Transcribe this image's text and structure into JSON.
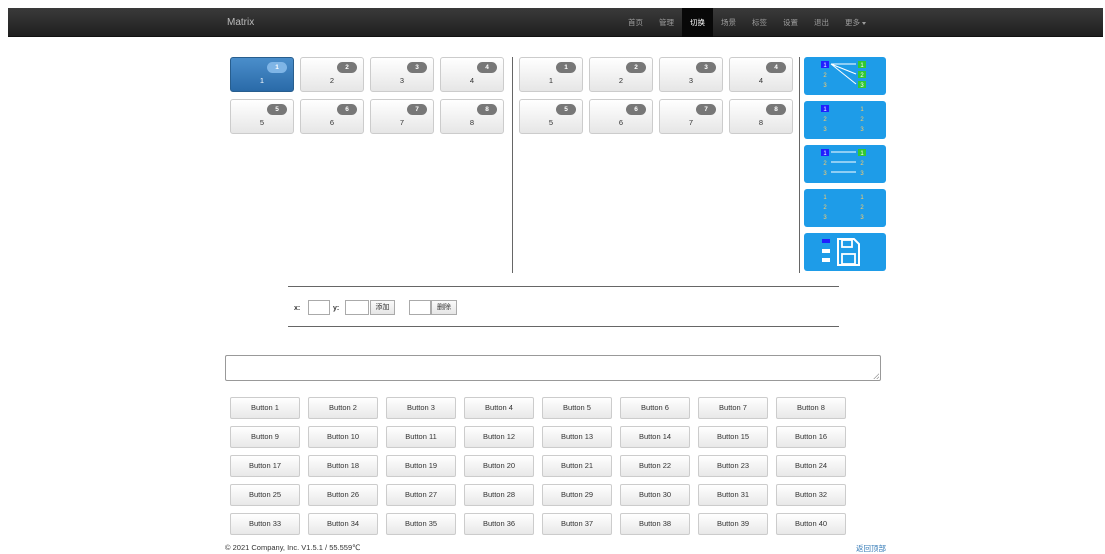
{
  "navbar": {
    "brand": "Matrix",
    "items": [
      {
        "label": "首页"
      },
      {
        "label": "管理"
      },
      {
        "label": "切换",
        "active": true
      },
      {
        "label": "场景"
      },
      {
        "label": "标签"
      },
      {
        "label": "设置"
      },
      {
        "label": "退出"
      },
      {
        "label": "更多",
        "dropdown": true
      }
    ]
  },
  "inputs": [
    {
      "label": "1",
      "badge": "1",
      "selected": true
    },
    {
      "label": "2",
      "badge": "2"
    },
    {
      "label": "3",
      "badge": "3"
    },
    {
      "label": "4",
      "badge": "4"
    },
    {
      "label": "5",
      "badge": "5"
    },
    {
      "label": "6",
      "badge": "6"
    },
    {
      "label": "7",
      "badge": "7"
    },
    {
      "label": "8",
      "badge": "8"
    }
  ],
  "outputs": [
    {
      "label": "1",
      "badge": "1"
    },
    {
      "label": "2",
      "badge": "2"
    },
    {
      "label": "3",
      "badge": "3"
    },
    {
      "label": "4",
      "badge": "4"
    },
    {
      "label": "5",
      "badge": "5"
    },
    {
      "label": "6",
      "badge": "6"
    },
    {
      "label": "7",
      "badge": "7"
    },
    {
      "label": "8",
      "badge": "8"
    }
  ],
  "modes": [
    {
      "icon": "one-to-many-routing-icon",
      "left": [
        "1",
        "2",
        "3"
      ],
      "right": [
        "1",
        "2",
        "3"
      ]
    },
    {
      "icon": "clear-routing-icon",
      "left": [
        "1",
        "2",
        "3"
      ],
      "right": [
        "1",
        "2",
        "3"
      ]
    },
    {
      "icon": "one-to-one-routing-icon",
      "left": [
        "1",
        "2",
        "3"
      ],
      "right": [
        "1",
        "2",
        "3"
      ]
    },
    {
      "icon": "disconnected-routing-icon",
      "left": [
        "1",
        "2",
        "3"
      ],
      "right": [
        "1",
        "2",
        "3"
      ]
    },
    {
      "icon": "save-scene-icon"
    }
  ],
  "colors": {
    "mode_bg": "#1e9ce8",
    "selected_tile": "#2a6aa8",
    "badge": "#777777",
    "link": "#337ab7"
  },
  "form": {
    "x_label": "x:",
    "y_label": "y:",
    "x_value": "",
    "y_value": "",
    "add_label": "添加",
    "delete_value": "",
    "delete_label": "删除"
  },
  "textarea_value": "",
  "buttons": [
    "Button 1",
    "Button 2",
    "Button 3",
    "Button 4",
    "Button 5",
    "Button 6",
    "Button 7",
    "Button 8",
    "Button 9",
    "Button 10",
    "Button 11",
    "Button 12",
    "Button 13",
    "Button 14",
    "Button 15",
    "Button 16",
    "Button 17",
    "Button 18",
    "Button 19",
    "Button 20",
    "Button 21",
    "Button 22",
    "Button 23",
    "Button 24",
    "Button 25",
    "Button 26",
    "Button 27",
    "Button 28",
    "Button 29",
    "Button 30",
    "Button 31",
    "Button 32",
    "Button 33",
    "Button 34",
    "Button 35",
    "Button 36",
    "Button 37",
    "Button 38",
    "Button 39",
    "Button 40"
  ],
  "footer": {
    "copyright": "© 2021 Company, Inc. V1.5.1 / 55.559℃",
    "back_to_top": "返回顶部"
  }
}
